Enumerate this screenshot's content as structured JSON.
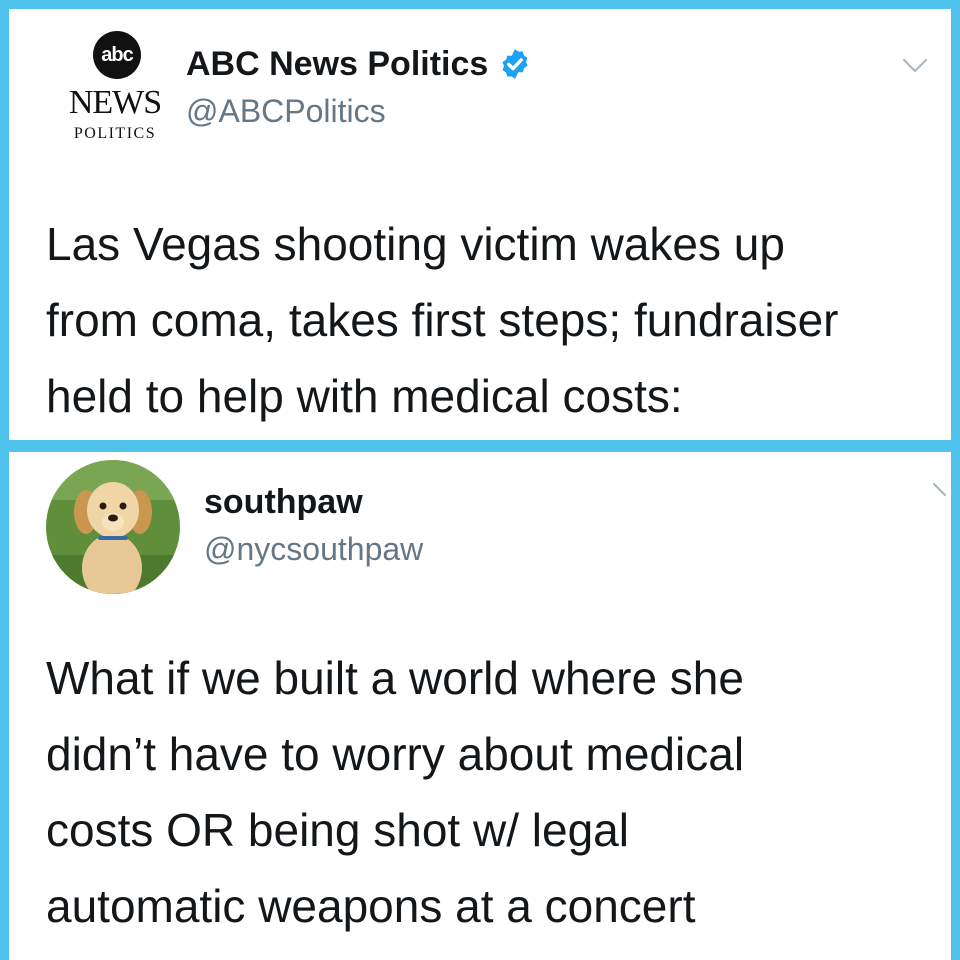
{
  "tweet1": {
    "logo": {
      "abc": "abc",
      "news": "NEWS",
      "politics": "POLITICS"
    },
    "display_name": "ABC News Politics",
    "handle": "@ABCPolitics",
    "verified_icon": "verified-badge-icon",
    "menu_icon": "chevron-down-icon",
    "lines": [
      "Las Vegas shooting victim wakes up",
      "from coma, takes first steps; fundraiser",
      "held to help with medical costs:"
    ]
  },
  "tweet2": {
    "avatar_icon": "puppy-avatar",
    "display_name": "southpaw",
    "handle": "@nycsouthpaw",
    "menu_icon": "chevron-down-icon",
    "lines": [
      "What if we built a world where she",
      "didn’t have to worry about medical",
      "costs OR being shot w/ legal",
      "automatic weapons at a concert"
    ]
  },
  "colors": {
    "frame": "#4fc3ec",
    "card": "#ffffff",
    "text": "#14171a",
    "handle": "#657786",
    "verified": "#1da1f2"
  }
}
